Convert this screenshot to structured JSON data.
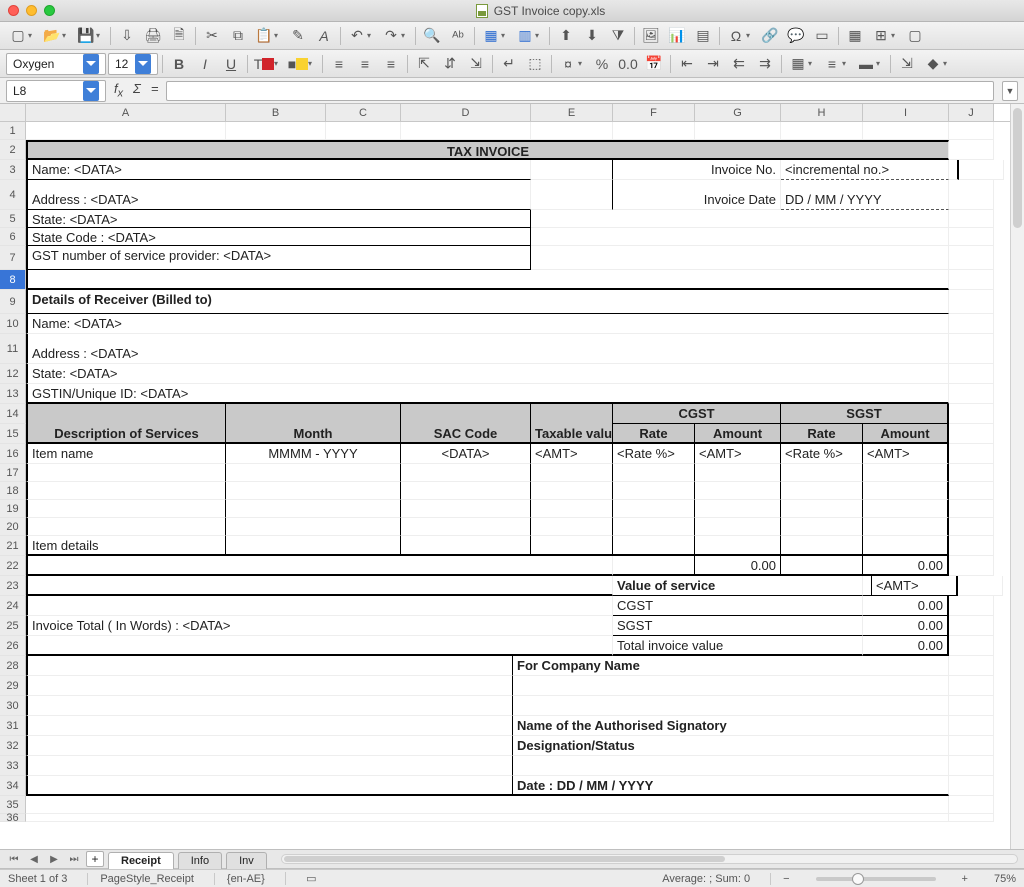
{
  "window": {
    "title": "GST Invoice copy.xls"
  },
  "toolbar2": {
    "font_name": "Oxygen",
    "font_size": "12"
  },
  "namebox": {
    "ref": "L8"
  },
  "columns": [
    "A",
    "B",
    "C",
    "D",
    "E",
    "F",
    "G",
    "H",
    "I",
    "J"
  ],
  "row_numbers": [
    "1",
    "2",
    "3",
    "4",
    "5",
    "6",
    "7",
    "8",
    "9",
    "10",
    "11",
    "12",
    "13",
    "14",
    "15",
    "16",
    "17",
    "18",
    "19",
    "20",
    "21",
    "22",
    "23",
    "24",
    "25",
    "26",
    "28",
    "29",
    "30",
    "31",
    "32",
    "33",
    "34",
    "35",
    "36"
  ],
  "selected_row": "8",
  "invoice": {
    "heading": "TAX INVOICE",
    "name": "Name: <DATA>",
    "address": "Address : <DATA>",
    "state": "State: <DATA>",
    "state_code": "State Code : <DATA>",
    "gst_provider": "GST number of service provider: <DATA>",
    "inv_no_label": "Invoice No.",
    "inv_no_value": "<incremental no.>",
    "inv_date_label": "Invoice Date",
    "inv_date_value": "DD / MM / YYYY",
    "receiver_heading": "Details of Receiver (Billed to)",
    "r_name": "Name: <DATA>",
    "r_address": "Address : <DATA>",
    "r_state": "State: <DATA>",
    "r_gstin": "GSTIN/Unique ID: <DATA>",
    "th_desc": "Description of Services",
    "th_month": "Month",
    "th_sac": "SAC Code",
    "th_tax": "Taxable value",
    "th_cgst": "CGST",
    "th_sgst": "SGST",
    "th_rate": "Rate",
    "th_amount": "Amount",
    "item_name": "Item name",
    "item_month": "MMMM  -  YYYY",
    "item_sac": "<DATA>",
    "item_tax": "<AMT>",
    "item_crate": "<Rate %>",
    "item_camt": "<AMT>",
    "item_srate": "<Rate %>",
    "item_samt": "<AMT>",
    "item_details": "Item details",
    "sub_camt": "0.00",
    "sub_samt": "0.00",
    "vos_label": "Value of service",
    "vos_value": "<AMT>",
    "cgst_label": "CGST",
    "cgst_value": "0.00",
    "sgst_label": "SGST",
    "sgst_value": "0.00",
    "total_label": "Total invoice value",
    "total_value": "0.00",
    "words": "Invoice Total ( In Words) : <DATA>",
    "for_company": "For Company Name",
    "sign_name": "Name of the  Authorised Signatory",
    "sign_desig": "Designation/Status",
    "sign_date": "Date :  DD / MM / YYYY"
  },
  "tabs": {
    "t1": "Receipt",
    "t2": "Info",
    "t3": "Inv",
    "add": "+"
  },
  "status": {
    "sheet": "Sheet 1 of 3",
    "pagestyle": "PageStyle_Receipt",
    "lang": "{en-AE}",
    "calc": "Average: ; Sum: 0",
    "zoom": "75%",
    "minus": "−",
    "plus": "+"
  }
}
